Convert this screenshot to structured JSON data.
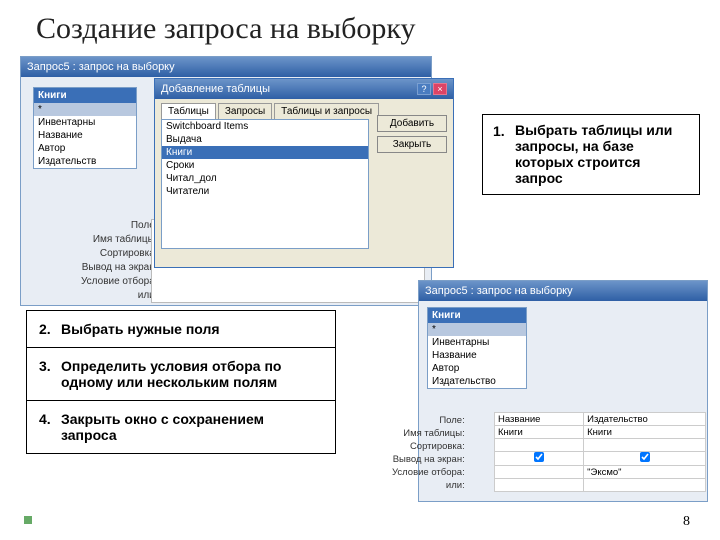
{
  "slide": {
    "title": "Создание запроса на выборку",
    "page": "8"
  },
  "win_q1": {
    "title": "Запрос5 : запрос на выборку",
    "table": {
      "name": "Книги",
      "fields": [
        "*",
        "Инвентарны",
        "Название",
        "Автор",
        "Издательств"
      ]
    },
    "grid_labels": [
      "Поле:",
      "Имя таблицы:",
      "Сортировка:",
      "Вывод на экран:",
      "Условие отбора:",
      "или:"
    ]
  },
  "dlg": {
    "title": "Добавление таблицы",
    "tabs": [
      "Таблицы",
      "Запросы",
      "Таблицы и запросы"
    ],
    "items": [
      "Switchboard Items",
      "Выдача",
      "Книги",
      "Сроки",
      "Читал_дол",
      "Читатели"
    ],
    "btn_add": "Добавить",
    "btn_close": "Закрыть"
  },
  "instr": {
    "s1_num": "1.",
    "s1": "Выбрать таблицы или запросы, на базе которых строится запрос",
    "s2_num": "2.",
    "s2": "Выбрать нужные поля",
    "s3_num": "3.",
    "s3": "Определить условия отбора по одному или нескольким полям",
    "s4_num": "4.",
    "s4": "Закрыть окно с сохранением запроса"
  },
  "win_q2": {
    "title": "Запрос5 : запрос на выборку",
    "table": {
      "name": "Книги",
      "fields": [
        "*",
        "Инвентарны",
        "Название",
        "Автор",
        "Издательство"
      ]
    },
    "grid_labels": [
      "Поле:",
      "Имя таблицы:",
      "Сортировка:",
      "Вывод на экран:",
      "Условие отбора:",
      "или:"
    ],
    "cols": [
      {
        "field": "Название",
        "table": "Книги",
        "show": true,
        "cond": ""
      },
      {
        "field": "Издательство",
        "table": "Книги",
        "show": true,
        "cond": "\"Эксмо\""
      }
    ]
  }
}
